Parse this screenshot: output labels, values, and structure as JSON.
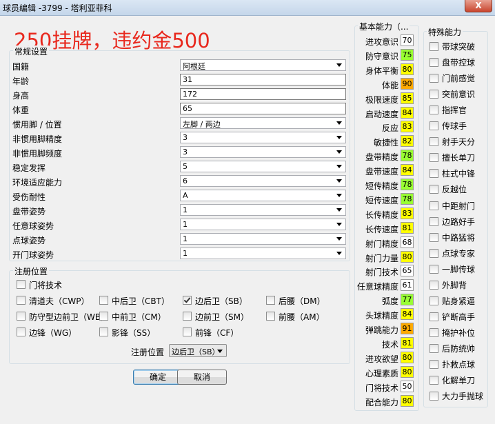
{
  "window": {
    "title": "球员编辑 -3799 - 塔利亚菲科",
    "close": "X"
  },
  "banner": "250挂牌，违约金500",
  "general": {
    "group_label": "常规设置",
    "rows": [
      {
        "label": "国籍",
        "value": "阿根廷",
        "kind": "select"
      },
      {
        "label": "年龄",
        "value": "31",
        "kind": "input"
      },
      {
        "label": "身高",
        "value": "172",
        "kind": "input"
      },
      {
        "label": "体重",
        "value": "65",
        "kind": "input"
      },
      {
        "label": "惯用脚 / 位置",
        "value": "左脚 / 两边",
        "kind": "select"
      },
      {
        "label": "非惯用脚精度",
        "value": "3",
        "kind": "select"
      },
      {
        "label": "非惯用脚频度",
        "value": "3",
        "kind": "select"
      },
      {
        "label": "稳定发挥",
        "value": "5",
        "kind": "select"
      },
      {
        "label": "环境适应能力",
        "value": "6",
        "kind": "select"
      },
      {
        "label": "受伤耐性",
        "value": "A",
        "kind": "select"
      },
      {
        "label": "盘带姿势",
        "value": "1",
        "kind": "select"
      },
      {
        "label": "任意球姿势",
        "value": "1",
        "kind": "select"
      },
      {
        "label": "点球姿势",
        "value": "1",
        "kind": "select"
      },
      {
        "label": "开门球姿势",
        "value": "1",
        "kind": "select"
      }
    ]
  },
  "positions": {
    "group_label": "注册位置",
    "items": [
      {
        "label": "门将技术",
        "checked": false
      },
      {
        "label": "清道夫（CWP）",
        "checked": false
      },
      {
        "label": "中后卫（CBT）",
        "checked": false
      },
      {
        "label": "边后卫（SB）",
        "checked": true
      },
      {
        "label": "后腰（DM）",
        "checked": false
      },
      {
        "label": "防守型边前卫（WB）",
        "checked": false
      },
      {
        "label": "中前卫（CM）",
        "checked": false
      },
      {
        "label": "边前卫（SM）",
        "checked": false
      },
      {
        "label": "前腰（AM）",
        "checked": false
      },
      {
        "label": "边锋（WG）",
        "checked": false
      },
      {
        "label": "影锋（SS）",
        "checked": false
      },
      {
        "label": "前锋（CF）",
        "checked": false
      }
    ],
    "registered_label": "注册位置",
    "registered_value": "边后卫（SB）"
  },
  "buttons": {
    "ok": "确定",
    "cancel": "取消"
  },
  "abilities": {
    "group_label": "基本能力（...",
    "colors": {
      "white": "#ffffff",
      "lime": "#99ff33",
      "yellow": "#ffff00",
      "orange": "#ffaa00"
    },
    "items": [
      {
        "label": "进攻意识",
        "value": "70",
        "color": "#ffffff"
      },
      {
        "label": "防守意识",
        "value": "75",
        "color": "#99ff33"
      },
      {
        "label": "身体平衡",
        "value": "80",
        "color": "#ffff00"
      },
      {
        "label": "体能",
        "value": "90",
        "color": "#ffaa00"
      },
      {
        "label": "极限速度",
        "value": "85",
        "color": "#ffff00"
      },
      {
        "label": "启动速度",
        "value": "84",
        "color": "#ffff00"
      },
      {
        "label": "反应",
        "value": "83",
        "color": "#ffff00"
      },
      {
        "label": "敏捷性",
        "value": "82",
        "color": "#ffff00"
      },
      {
        "label": "盘带精度",
        "value": "78",
        "color": "#99ff33"
      },
      {
        "label": "盘带速度",
        "value": "84",
        "color": "#ffff00"
      },
      {
        "label": "短传精度",
        "value": "78",
        "color": "#99ff33"
      },
      {
        "label": "短传速度",
        "value": "78",
        "color": "#99ff33"
      },
      {
        "label": "长传精度",
        "value": "83",
        "color": "#ffff00"
      },
      {
        "label": "长传速度",
        "value": "81",
        "color": "#ffff00"
      },
      {
        "label": "射门精度",
        "value": "68",
        "color": "#ffffff"
      },
      {
        "label": "射门力量",
        "value": "80",
        "color": "#ffff00"
      },
      {
        "label": "射门技术",
        "value": "65",
        "color": "#ffffff"
      },
      {
        "label": "任意球精度",
        "value": "61",
        "color": "#ffffff"
      },
      {
        "label": "弧度",
        "value": "77",
        "color": "#99ff33"
      },
      {
        "label": "头球精度",
        "value": "84",
        "color": "#ffff00"
      },
      {
        "label": "弹跳能力",
        "value": "91",
        "color": "#ffaa00"
      },
      {
        "label": "技术",
        "value": "81",
        "color": "#ffff00"
      },
      {
        "label": "进攻欲望",
        "value": "80",
        "color": "#ffff00"
      },
      {
        "label": "心理素质",
        "value": "80",
        "color": "#ffff00"
      },
      {
        "label": "门将技术",
        "value": "50",
        "color": "#ffffff"
      },
      {
        "label": "配合能力",
        "value": "80",
        "color": "#ffff00"
      }
    ]
  },
  "skills": {
    "group_label": "特殊能力",
    "items": [
      {
        "label": "带球突破",
        "checked": false
      },
      {
        "label": "盘带控球",
        "checked": false
      },
      {
        "label": "门前感觉",
        "checked": false
      },
      {
        "label": "突前意识",
        "checked": false
      },
      {
        "label": "指挥官",
        "checked": false
      },
      {
        "label": "传球手",
        "checked": false
      },
      {
        "label": "射手天分",
        "checked": false
      },
      {
        "label": "擅长单刀",
        "checked": false
      },
      {
        "label": "柱式中锋",
        "checked": false
      },
      {
        "label": "反越位",
        "checked": false
      },
      {
        "label": "中距射门",
        "checked": false
      },
      {
        "label": "边路好手",
        "checked": false
      },
      {
        "label": "中路猛将",
        "checked": false
      },
      {
        "label": "点球专家",
        "checked": false
      },
      {
        "label": "一脚传球",
        "checked": false
      },
      {
        "label": "外脚背",
        "checked": false
      },
      {
        "label": "贴身紧逼",
        "checked": false
      },
      {
        "label": "铲断高手",
        "checked": false
      },
      {
        "label": "掩护补位",
        "checked": false
      },
      {
        "label": "后防统帅",
        "checked": false
      },
      {
        "label": "扑救点球",
        "checked": false
      },
      {
        "label": "化解单刀",
        "checked": false
      },
      {
        "label": "大力手抛球",
        "checked": false
      }
    ]
  }
}
